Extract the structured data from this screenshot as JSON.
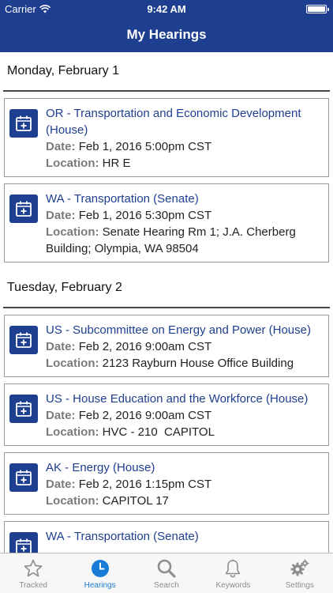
{
  "status_bar": {
    "carrier": "Carrier",
    "time": "9:42 AM"
  },
  "nav": {
    "title": "My Hearings"
  },
  "days": [
    {
      "label": "Monday, February 1",
      "hearings": [
        {
          "title": "OR - Transportation and Economic Development (House)",
          "date_label": "Date:",
          "date": "Feb 1, 2016 5:00pm CST",
          "location_label": "Location:",
          "location": "HR E"
        },
        {
          "title": "WA - Transportation (Senate)",
          "date_label": "Date:",
          "date": "Feb 1, 2016 5:30pm CST",
          "location_label": "Location:",
          "location": "Senate Hearing Rm 1; J.A. Cherberg Building; Olympia, WA 98504"
        }
      ]
    },
    {
      "label": "Tuesday, February 2",
      "hearings": [
        {
          "title": "US - Subcommittee on Energy and Power (House)",
          "date_label": "Date:",
          "date": "Feb 2, 2016 9:00am CST",
          "location_label": "Location:",
          "location": "2123 Rayburn House Office Building"
        },
        {
          "title": "US - House Education and the Workforce (House)",
          "date_label": "Date:",
          "date": "Feb 2, 2016 9:00am CST",
          "location_label": "Location:",
          "location": "HVC - 210  CAPITOL"
        },
        {
          "title": "AK - Energy (House)",
          "date_label": "Date:",
          "date": "Feb 2, 2016 1:15pm CST",
          "location_label": "Location:",
          "location": "CAPITOL 17"
        },
        {
          "title": "WA - Transportation (Senate)",
          "date_label": "",
          "date": "",
          "location_label": "",
          "location": ""
        }
      ]
    }
  ],
  "tabs": [
    {
      "label": "Tracked",
      "icon": "star-icon",
      "active": false
    },
    {
      "label": "Hearings",
      "icon": "clock-icon",
      "active": true
    },
    {
      "label": "Search",
      "icon": "search-icon",
      "active": false
    },
    {
      "label": "Keywords",
      "icon": "bell-icon",
      "active": false
    },
    {
      "label": "Settings",
      "icon": "gear-icon",
      "active": false
    }
  ],
  "colors": {
    "brand": "#1e3f8f",
    "active_tab": "#1a7bd6",
    "inactive_tab": "#8e8e8e"
  }
}
